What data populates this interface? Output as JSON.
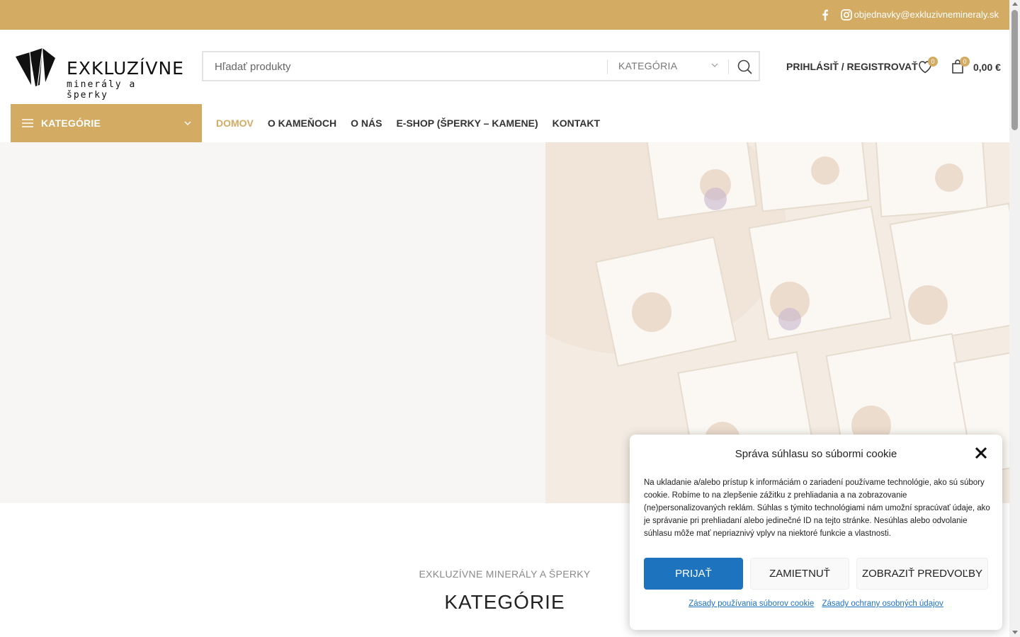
{
  "topbar": {
    "email": "objednavky@exkluzivnemineraly.sk"
  },
  "logo": {
    "brand": "EXKLUZÍVNE",
    "tagline": "minerály a šperky"
  },
  "search": {
    "placeholder": "Hľadať produkty",
    "category_label": "KATEGÓRIA"
  },
  "header": {
    "login_label": "PRIHLÁSIŤ / REGISTROVAŤ",
    "wishlist_count": "0",
    "cart_count": "0",
    "cart_total": "0,00 €"
  },
  "nav": {
    "categories_label": "KATEGÓRIE",
    "items": [
      "DOMOV",
      "O KAMEŇOCH",
      "O NÁS",
      "E-SHOP (ŠPERKY – KAMENE)",
      "KONTAKT"
    ],
    "active_index": 0
  },
  "section": {
    "subtitle": "EXKLUZÍVNE MINERÁLY A ŠPERKY",
    "title": "KATEGÓRIE"
  },
  "cookie": {
    "title": "Správa súhlasu so súbormi cookie",
    "text": "Na ukladanie a/alebo prístup k informáciám o zariadení používame technológie, ako sú súbory cookie. Robíme to na zlepšenie zážitku z prehliadania a na zobrazovanie (ne)personalizovaných reklám. Súhlas s týmito technológiami nám umožní spracúvať údaje, ako je správanie pri prehliadaní alebo jedinečné ID na tejto stránke. Nesúhlas alebo odvolanie súhlasu môže mať nepriaznivý vplyv na niektoré funkcie a vlastnosti.",
    "accept": "PRIJAŤ",
    "deny": "ZAMIETNUŤ",
    "preferences": "ZOBRAZIŤ PREDVOĽBY",
    "cookie_policy_link": "Zásady používania súborov cookie",
    "privacy_policy_link": "Zásady ochrany osobných údajov"
  },
  "colors": {
    "accent": "#d3ab63",
    "primary_button": "#1e73be"
  }
}
